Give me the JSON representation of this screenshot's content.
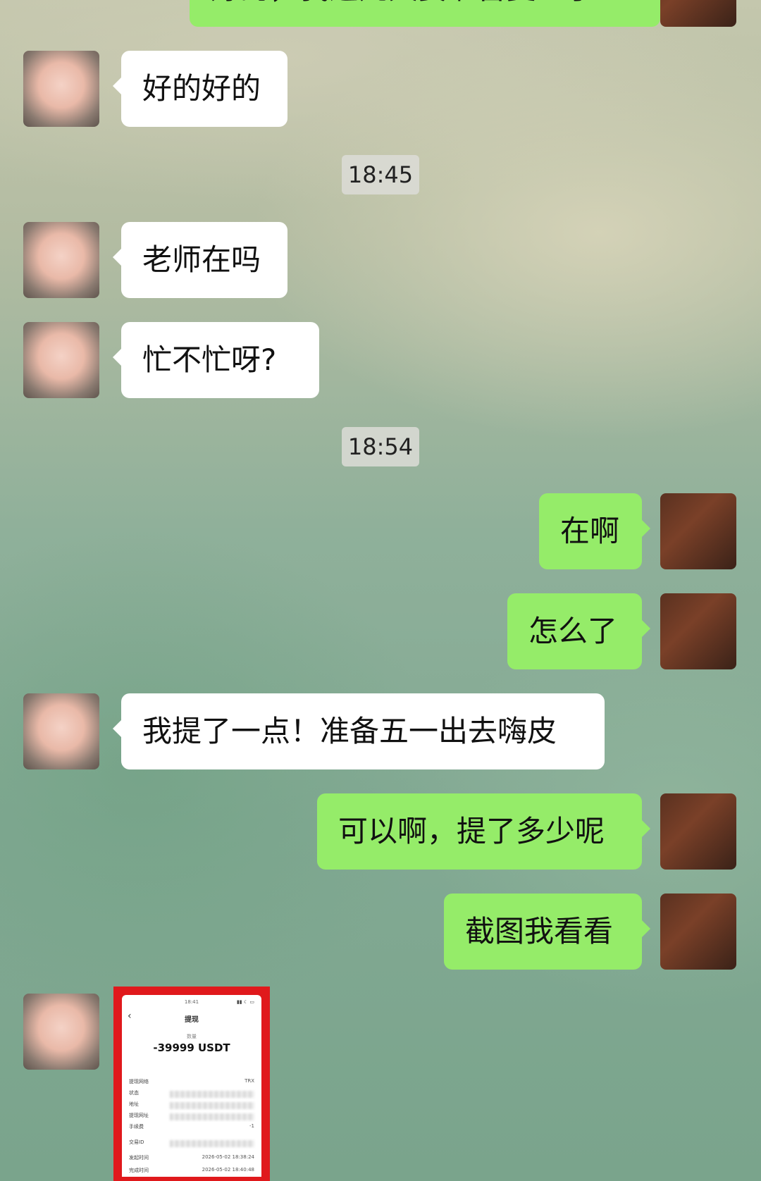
{
  "messages": [
    {
      "side": "right",
      "text": "好的，我这几天要准备复查了"
    },
    {
      "side": "left",
      "text": "好的好的"
    },
    {
      "time": "18:45"
    },
    {
      "side": "left",
      "text": "老师在吗"
    },
    {
      "side": "left",
      "text": "忙不忙呀?"
    },
    {
      "time": "18:54"
    },
    {
      "side": "right",
      "text": "在啊"
    },
    {
      "side": "right",
      "text": "怎么了"
    },
    {
      "side": "left",
      "text": "我提了一点！准备五一出去嗨皮"
    },
    {
      "side": "right",
      "text": "可以啊，提了多少呢"
    },
    {
      "side": "right",
      "text": "截图我看看"
    }
  ],
  "screenshot": {
    "status_time": "18:41",
    "status_icons": "▮▮ ☾ ▭",
    "back": "‹",
    "title": "提现",
    "qty_label": "数量",
    "amount": "-39999 USDT",
    "rows": [
      {
        "label": "提现网络",
        "value": "TRX"
      },
      {
        "label": "状态",
        "value": ""
      },
      {
        "label": "地址",
        "value": ""
      },
      {
        "label": "提现网址",
        "value": ""
      },
      {
        "label": "手续费",
        "value": "-1"
      },
      {
        "label": "交易ID",
        "value": ""
      },
      {
        "label": "发起时间",
        "value": "2026-05-02  18:38:24"
      },
      {
        "label": "完成时间",
        "value": "2026-05-02  18:40:48"
      }
    ]
  },
  "icons": {
    "pig_avatar": "pig-avatar-icon",
    "woman_avatar": "woman-avatar-icon"
  }
}
